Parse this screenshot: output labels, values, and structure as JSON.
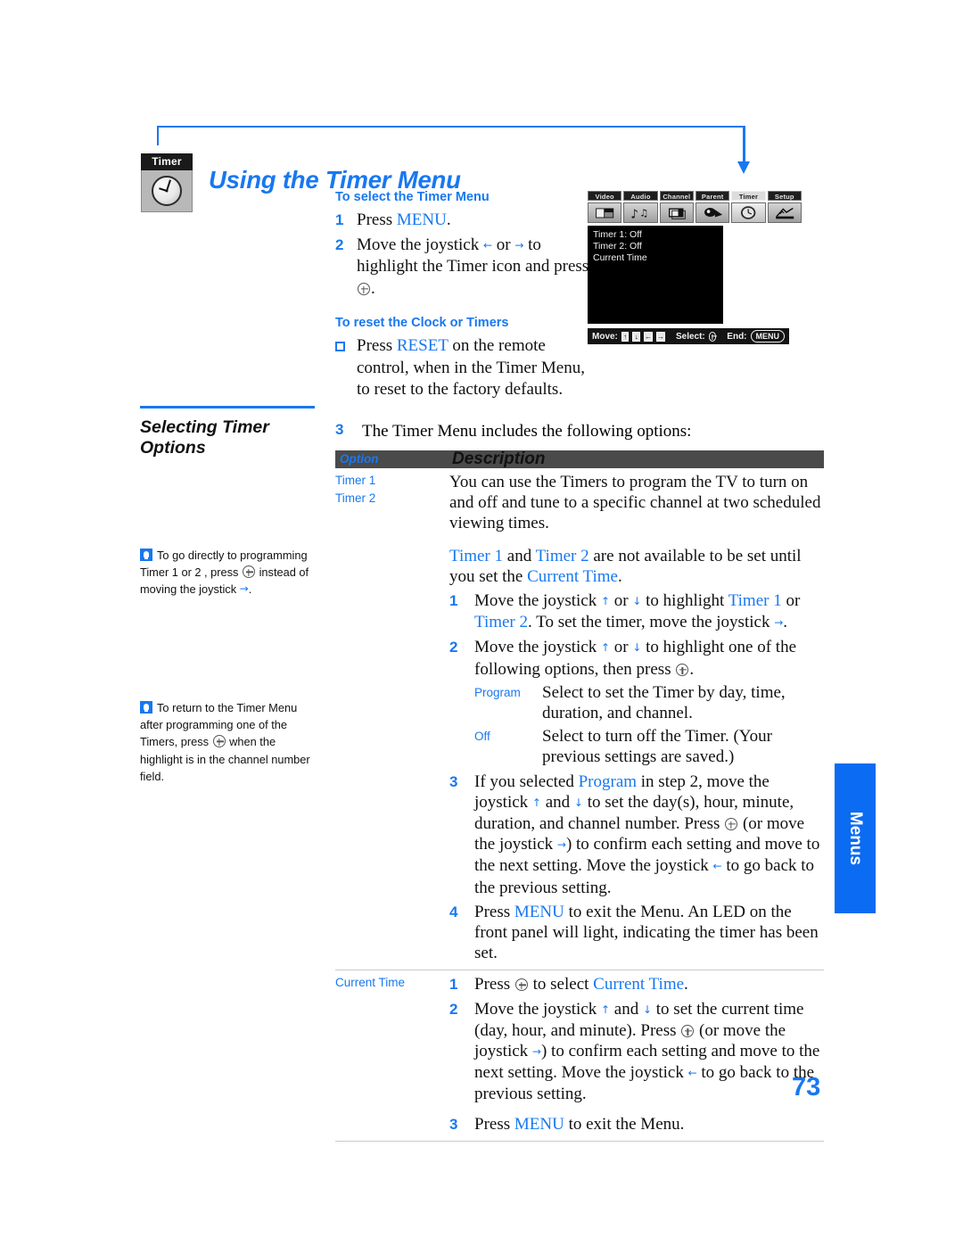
{
  "page": {
    "title": "Using the Timer Menu",
    "number": "73",
    "side_tab": "Menus",
    "badge_label": "Timer"
  },
  "section": {
    "heading_line1": "Selecting Timer",
    "heading_line2": "Options"
  },
  "select_menu": {
    "subhead": "To select the Timer Menu",
    "step1_num": "1",
    "step1_a": "Press ",
    "step1_key": "MENU",
    "step1_b": ".",
    "step2_num": "2",
    "step2_a": "Move the joystick ",
    "step2_left": "←",
    "step2_or": " or ",
    "step2_right": "→",
    "step2_b": " to highlight the Timer icon and press ",
    "step2_c": "."
  },
  "reset_clock": {
    "subhead": "To reset the Clock or Timers",
    "a": "Press ",
    "key": "RESET",
    "b": " on the remote control, when in the Timer Menu, to reset to the factory defaults."
  },
  "tips": [
    {
      "a": "To go directly to programming Timer 1 or 2 , press ",
      "b": " instead of moving the joystick ",
      "arrow": "→",
      "c": "."
    },
    {
      "a": "To return to the Timer Menu after programming one of the Timers, press ",
      "b": " when the highlight is in the channel number field."
    }
  ],
  "osd": {
    "tabs": [
      "Video",
      "Audio",
      "Channel",
      "Parent",
      "Timer",
      "Setup"
    ],
    "active_tab": "Timer",
    "screen_lines": [
      "Timer 1: Off",
      "Timer 2: Off",
      "Current Time"
    ],
    "footer": {
      "move_label": "Move:",
      "keys": [
        "↑",
        "↓",
        "←",
        "→"
      ],
      "select_label": "Select:",
      "end_label": "End:",
      "end_key": "MENU"
    }
  },
  "table_intro": {
    "num": "3",
    "text": "The Timer Menu includes the following options:"
  },
  "table": {
    "headers": {
      "option": "Option",
      "description": "Description"
    },
    "row1": {
      "option_line1": "Timer 1",
      "option_line2": "Timer 2",
      "para1": "You can use the Timers to program the TV to turn on and off and tune to a specific channel at two scheduled viewing times.",
      "para2_a": "Timer 1",
      "para2_b": " and ",
      "para2_c": "Timer 2",
      "para2_d": " are not available to be set until you set the ",
      "para2_e": "Current Time",
      "para2_f": ".",
      "steps": {
        "s1_num": "1",
        "s1_a": "Move the joystick ",
        "s1_up": "↑",
        "s1_or": " or ",
        "s1_dn": "↓",
        "s1_b": " to highlight ",
        "s1_t1": "Timer 1",
        "s1_c": " or ",
        "s1_t2": "Timer 2",
        "s1_d": ". To set the timer, move the joystick ",
        "s1_rt": "→",
        "s1_e": ".",
        "s2_num": "2",
        "s2_a": "Move the joystick ",
        "s2_up": "↑",
        "s2_or": " or ",
        "s2_dn": "↓",
        "s2_b": " to highlight one of the following options, then press ",
        "s2_c": ".",
        "def_program_term": "Program",
        "def_program_text": "Select to set the Timer by day, time, duration, and channel.",
        "def_off_term": "Off",
        "def_off_text": "Select to turn off the Timer. (Your previous settings are saved.)",
        "s3_num": "3",
        "s3_a": "If you selected ",
        "s3_prog": "Program",
        "s3_b": " in step 2, move the joystick ",
        "s3_up": "↑",
        "s3_c": " and ",
        "s3_dn": "↓",
        "s3_d": " to set the day(s), hour, minute, duration, and channel number. Press ",
        "s3_e": " (or move the joystick ",
        "s3_rt": "→",
        "s3_f": ") to confirm each setting and move to the next setting. Move the joystick ",
        "s3_lt": "←",
        "s3_g": " to go back to the previous setting.",
        "s4_num": "4",
        "s4_a": "Press ",
        "s4_key": "MENU",
        "s4_b": " to exit the Menu. An LED on the front panel will light, indicating the timer has been set."
      }
    },
    "row2": {
      "option": "Current Time",
      "steps": {
        "s1_num": "1",
        "s1_a": "Press ",
        "s1_b": " to select ",
        "s1_ct": "Current Time",
        "s1_c": ".",
        "s2_num": "2",
        "s2_a": "Move the joystick ",
        "s2_up": "↑",
        "s2_and": " and ",
        "s2_dn": "↓",
        "s2_b": " to set the current time (day, hour, and minute). Press ",
        "s2_c": " (or move the joystick ",
        "s2_rt": "→",
        "s2_d": ") to confirm each setting and move to the next setting. Move the joystick ",
        "s2_lt": "←",
        "s2_e": " to go back to the previous setting.",
        "s3_num": "3",
        "s3_a": "Press ",
        "s3_key": "MENU",
        "s3_b": " to exit the Menu."
      }
    }
  },
  "colors": {
    "accent_blue": "#1878f0",
    "tab_blue": "#0b6bf2",
    "table_header_bg": "#4a4a4a"
  }
}
